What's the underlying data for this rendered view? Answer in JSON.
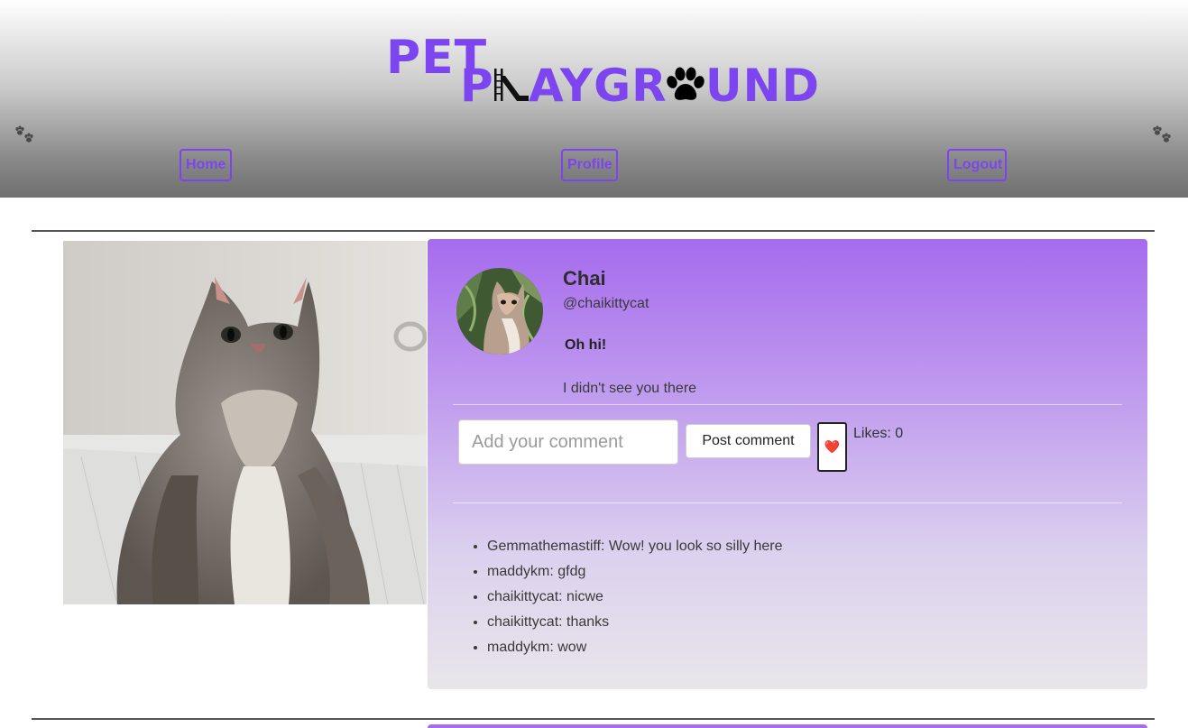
{
  "logo": {
    "line1": "PET",
    "line2_part1": "P",
    "line2_part2": "AYGR",
    "line2_part3": "UND",
    "text_color": "#7c45f0"
  },
  "nav": {
    "home_label": "Home",
    "profile_label": "Profile",
    "logout_label": "Logout"
  },
  "post": {
    "display_name": "Chai",
    "handle": "@chaikittycat",
    "title": "Oh hi!",
    "body": "I didn't see you there",
    "comment_placeholder": "Add your comment",
    "post_comment_label": "Post comment",
    "like_icon": "❤️",
    "likes_text": "Likes: 0",
    "comments": [
      "Gemmathemastiff: Wow! you look so silly here",
      "maddykm: gfdg",
      "chaikittycat: nicwe",
      "chaikittycat: thanks",
      "maddykm: wow"
    ]
  },
  "colors": {
    "accent": "#7c45f0",
    "card_top": "#a66bee",
    "card_bottom": "#e8e6ea"
  }
}
